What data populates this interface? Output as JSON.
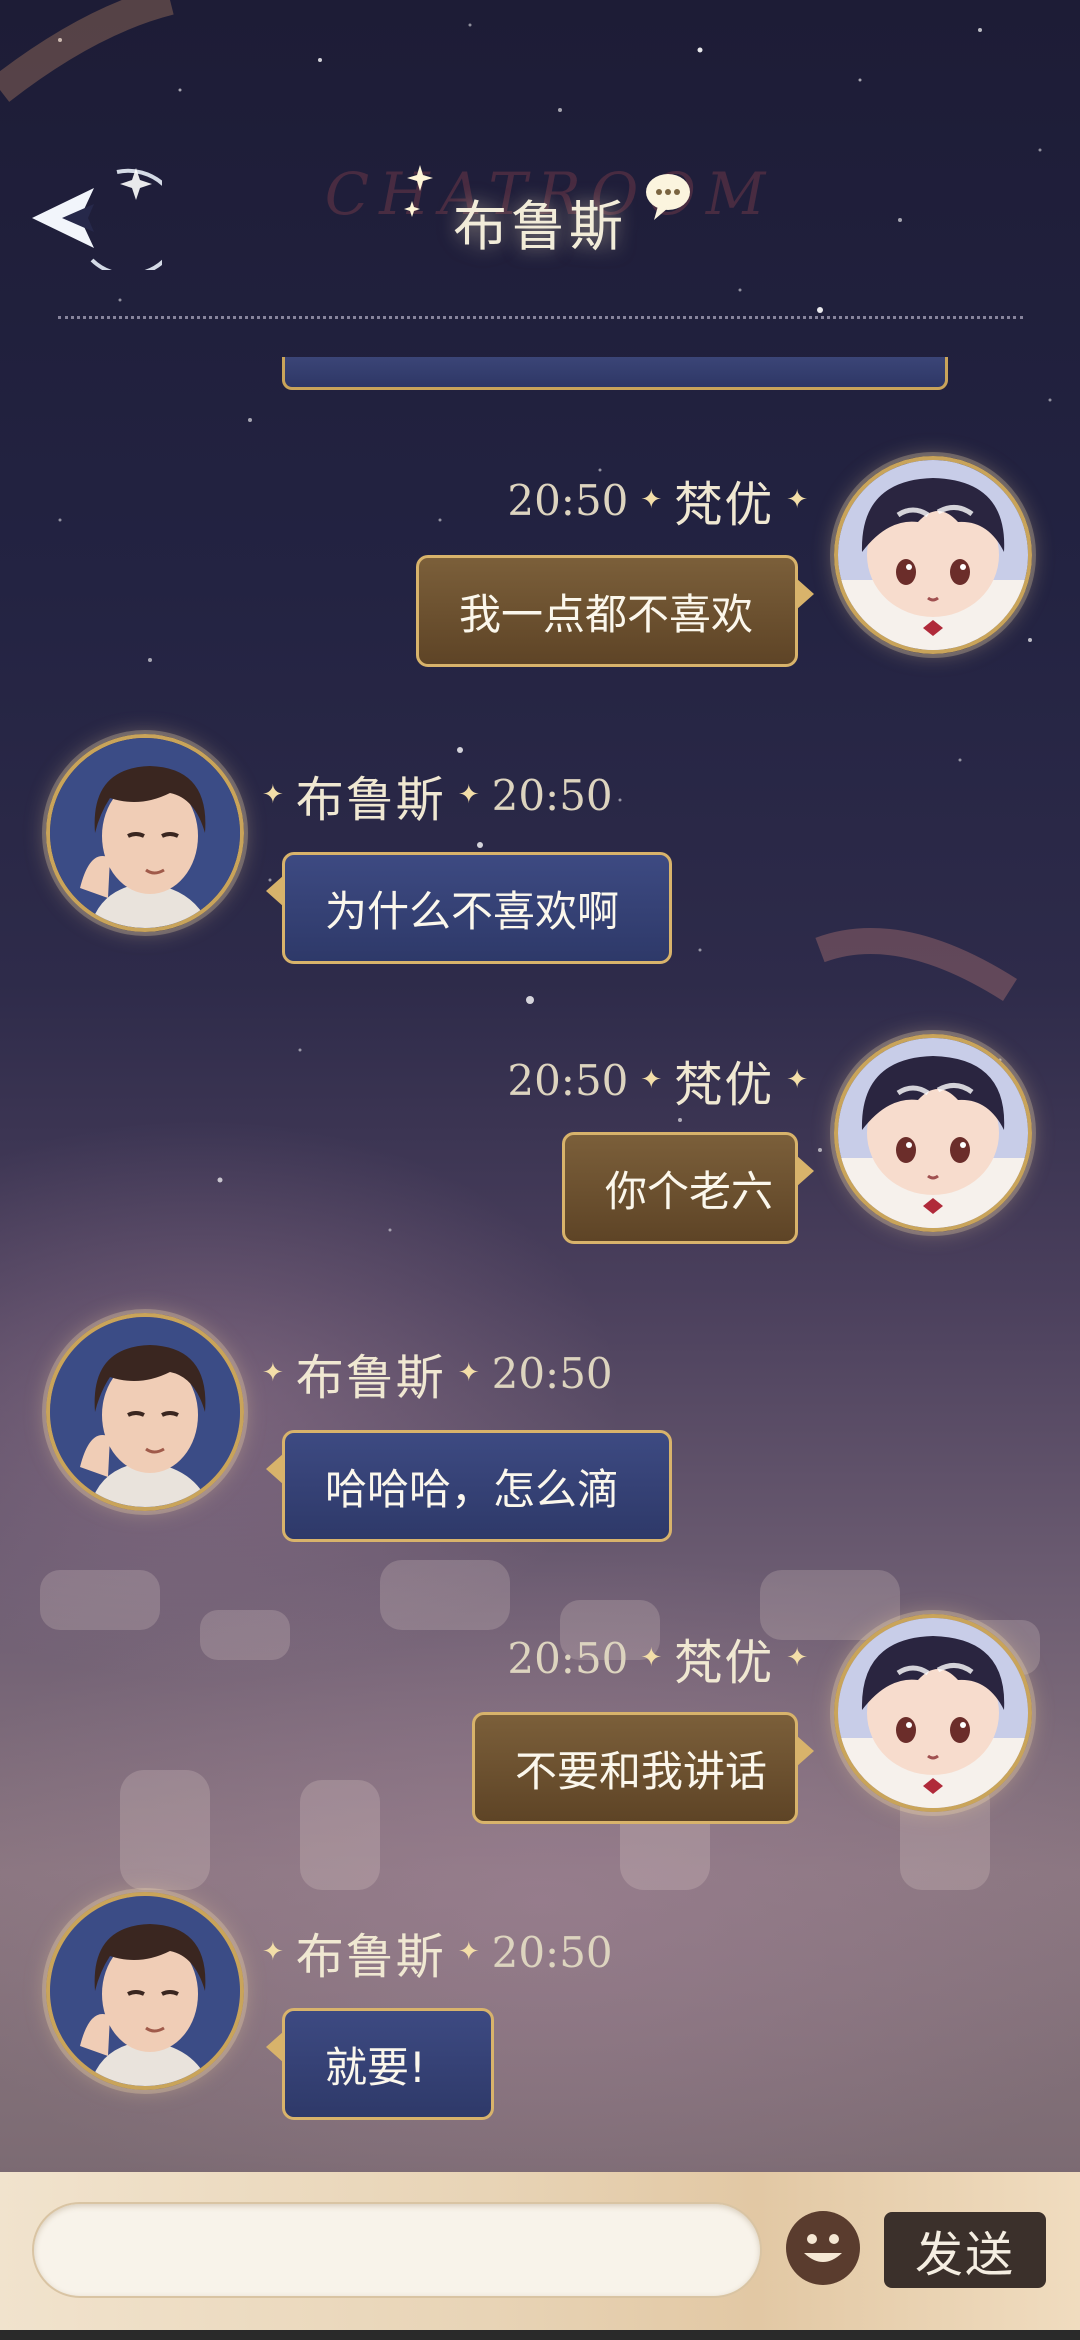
{
  "header": {
    "title": "布鲁斯",
    "watermark": "CHATROOM"
  },
  "messages": [
    {
      "side": "right",
      "name": "梵优",
      "time": "20:50",
      "text": "我一点都不喜欢"
    },
    {
      "side": "left",
      "name": "布鲁斯",
      "time": "20:50",
      "text": "为什么不喜欢啊"
    },
    {
      "side": "right",
      "name": "梵优",
      "time": "20:50",
      "text": "你个老六"
    },
    {
      "side": "left",
      "name": "布鲁斯",
      "time": "20:50",
      "text": "哈哈哈，怎么滴"
    },
    {
      "side": "right",
      "name": "梵优",
      "time": "20:50",
      "text": "不要和我讲话"
    },
    {
      "side": "left",
      "name": "布鲁斯",
      "time": "20:50",
      "text": "就要!"
    }
  ],
  "input": {
    "value": "",
    "placeholder": "",
    "send_label": "发送"
  },
  "icons": {
    "back": "back-arrow-icon",
    "chat": "chat-bubble-icon",
    "emoji": "emoji-icon",
    "sparkle": "sparkle-icon"
  },
  "colors": {
    "accent_gold": "#c9a45a",
    "bubble_right": "#6b5030",
    "bubble_left": "#35407a",
    "send_button": "#3b302b"
  }
}
